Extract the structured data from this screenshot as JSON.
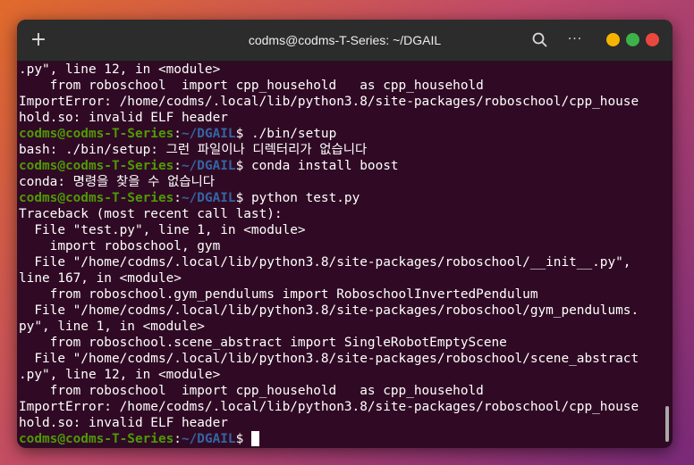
{
  "window": {
    "title": "codms@codms-T-Series: ~/DGAIL"
  },
  "titlebar": {
    "new_tab_icon": "plus-icon",
    "new_tab_glyph": "+",
    "search_icon": "search-icon",
    "menu_icon": "ellipsis-icon",
    "menu_glyph": "···",
    "colors": {
      "minimize": "#f4b400",
      "maximize": "#3bb34a",
      "close": "#e9483e"
    }
  },
  "terminal": {
    "colors": {
      "background": "#300a24",
      "text": "#ffffff",
      "prompt_user": "#4e9a06",
      "prompt_path": "#3465a4"
    },
    "prompt": {
      "user": "codms@codms-T-Series",
      "sep": ":",
      "path": "~/DGAIL",
      "sigil": "$"
    },
    "lines": [
      {
        "type": "out",
        "text": ".py\", line 12, in <module>"
      },
      {
        "type": "out",
        "text": "    from roboschool  import cpp_household   as cpp_household"
      },
      {
        "type": "out",
        "text": "ImportError: /home/codms/.local/lib/python3.8/site-packages/roboschool/cpp_house"
      },
      {
        "type": "out",
        "text": "hold.so: invalid ELF header"
      },
      {
        "type": "prompt",
        "cmd": " ./bin/setup"
      },
      {
        "type": "out",
        "text": "bash: ./bin/setup: 그런 파일이나 디렉터리가 없습니다"
      },
      {
        "type": "prompt",
        "cmd": " conda install boost"
      },
      {
        "type": "out",
        "text": "conda: 명령을 찾을 수 없습니다"
      },
      {
        "type": "prompt",
        "cmd": " python test.py"
      },
      {
        "type": "out",
        "text": "Traceback (most recent call last):"
      },
      {
        "type": "out",
        "text": "  File \"test.py\", line 1, in <module>"
      },
      {
        "type": "out",
        "text": "    import roboschool, gym"
      },
      {
        "type": "out",
        "text": "  File \"/home/codms/.local/lib/python3.8/site-packages/roboschool/__init__.py\","
      },
      {
        "type": "out",
        "text": "line 167, in <module>"
      },
      {
        "type": "out",
        "text": "    from roboschool.gym_pendulums import RoboschoolInvertedPendulum"
      },
      {
        "type": "out",
        "text": "  File \"/home/codms/.local/lib/python3.8/site-packages/roboschool/gym_pendulums."
      },
      {
        "type": "out",
        "text": "py\", line 1, in <module>"
      },
      {
        "type": "out",
        "text": "    from roboschool.scene_abstract import SingleRobotEmptyScene"
      },
      {
        "type": "out",
        "text": "  File \"/home/codms/.local/lib/python3.8/site-packages/roboschool/scene_abstract"
      },
      {
        "type": "out",
        "text": ".py\", line 12, in <module>"
      },
      {
        "type": "out",
        "text": "    from roboschool  import cpp_household   as cpp_household"
      },
      {
        "type": "out",
        "text": "ImportError: /home/codms/.local/lib/python3.8/site-packages/roboschool/cpp_house"
      },
      {
        "type": "out",
        "text": "hold.so: invalid ELF header"
      },
      {
        "type": "prompt",
        "cmd": " ",
        "cursor": true
      }
    ]
  }
}
